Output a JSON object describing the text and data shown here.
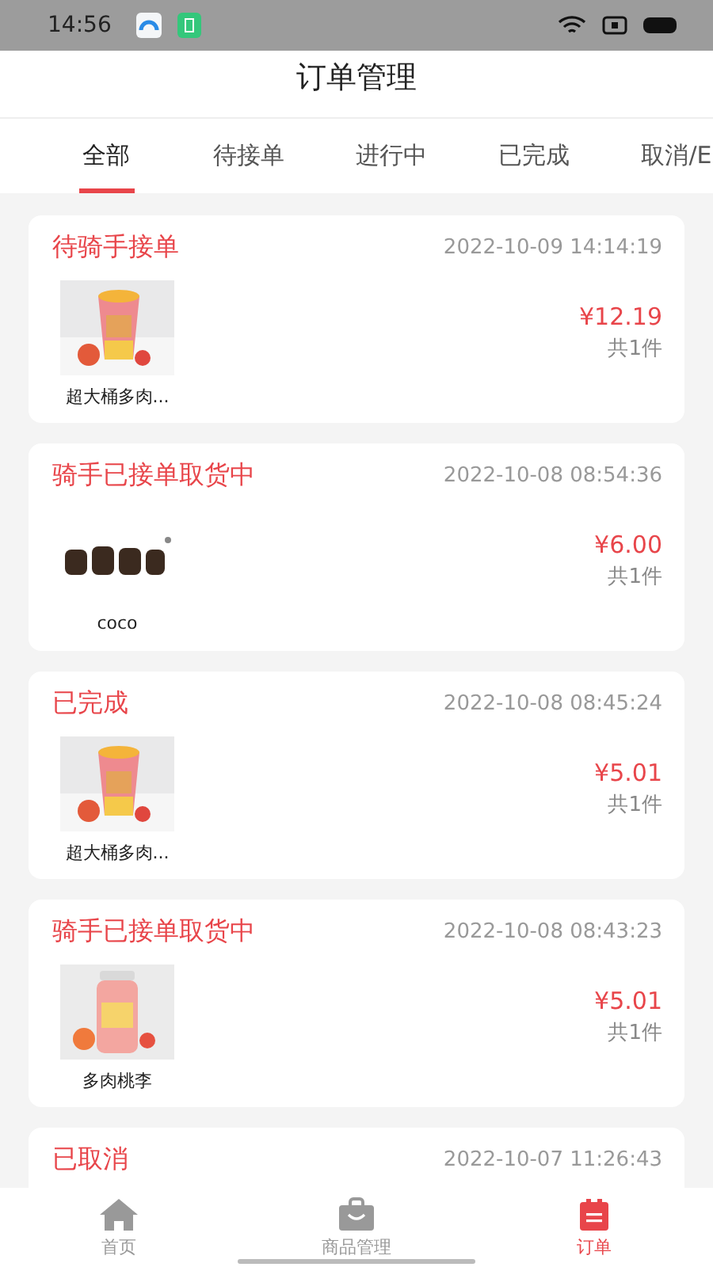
{
  "status_bar": {
    "time": "14:56"
  },
  "header": {
    "title": "订单管理"
  },
  "tabs": [
    {
      "label": "全部",
      "selected": true
    },
    {
      "label": "待接单",
      "selected": false
    },
    {
      "label": "进行中",
      "selected": false
    },
    {
      "label": "已完成",
      "selected": false
    },
    {
      "label": "取消/E",
      "selected": false
    }
  ],
  "orders": [
    {
      "status": "待骑手接单",
      "time": "2022-10-09 14:14:19",
      "item": {
        "kind": "drink",
        "name": "超大桶多肉..."
      },
      "price": "¥12.19",
      "count": "共1件"
    },
    {
      "status": "骑手已接单取货中",
      "time": "2022-10-08 08:54:36",
      "item": {
        "kind": "logo",
        "name": "coco"
      },
      "price": "¥6.00",
      "count": "共1件"
    },
    {
      "status": "已完成",
      "time": "2022-10-08 08:45:24",
      "item": {
        "kind": "drink",
        "name": "超大桶多肉..."
      },
      "price": "¥5.01",
      "count": "共1件"
    },
    {
      "status": "骑手已接单取货中",
      "time": "2022-10-08 08:43:23",
      "item": {
        "kind": "bottle",
        "name": "多肉桃李"
      },
      "price": "¥5.01",
      "count": "共1件"
    },
    {
      "status": "已取消",
      "time": "2022-10-07 11:26:43"
    }
  ],
  "bottom_nav": [
    {
      "label": "首页",
      "kind": "home",
      "selected": false
    },
    {
      "label": "商品管理",
      "kind": "bag",
      "selected": false
    },
    {
      "label": "订单",
      "kind": "orders",
      "selected": true
    }
  ]
}
